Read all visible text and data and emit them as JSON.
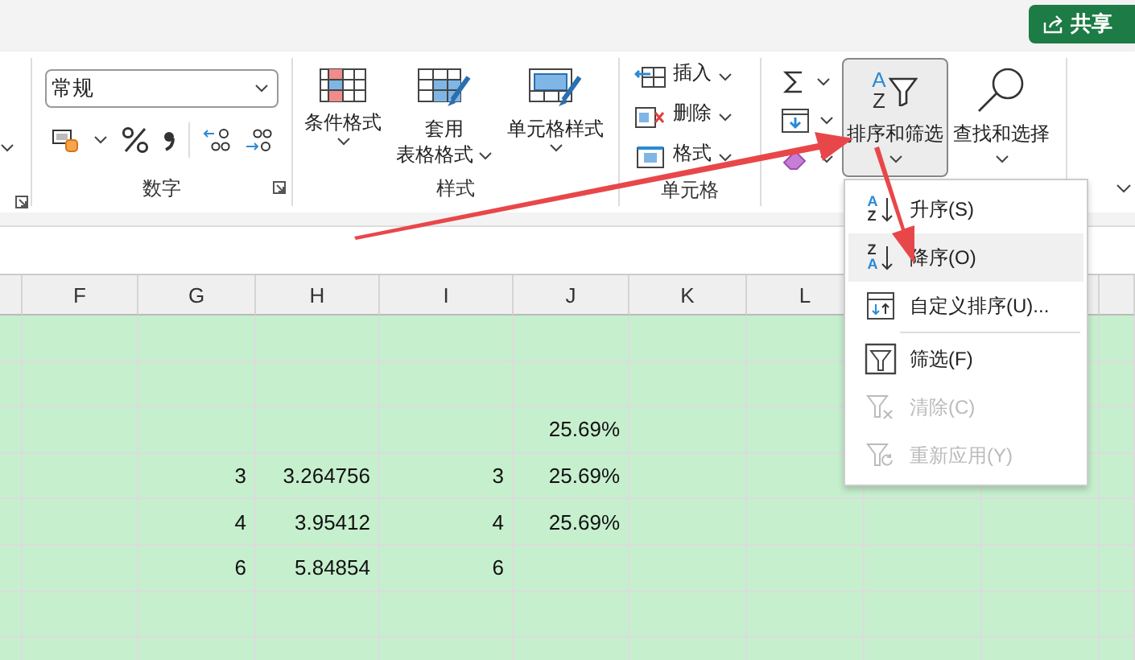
{
  "share_button": {
    "label": "共享"
  },
  "ribbon": {
    "number": {
      "label": "数字",
      "format": "常规"
    },
    "styles": {
      "label": "样式",
      "buttons": [
        {
          "lines": [
            "条件格式"
          ],
          "kind": "conditional"
        },
        {
          "lines": [
            "套用",
            "表格格式"
          ],
          "kind": "table"
        },
        {
          "lines": [
            "单元格样式"
          ],
          "kind": "cellstyle"
        }
      ]
    },
    "cells": {
      "label": "单元格",
      "items": [
        {
          "label": "插入",
          "kind": "insert"
        },
        {
          "label": "删除",
          "kind": "delete"
        },
        {
          "label": "格式",
          "kind": "format"
        }
      ]
    },
    "editing": {
      "sort_filter": {
        "label": "排序和筛选",
        "icon_letters": [
          "A",
          "Z"
        ],
        "pressed": true
      },
      "find_select": {
        "label": "查找和选择"
      }
    }
  },
  "columns": [
    "F",
    "G",
    "H",
    "I",
    "J",
    "K",
    "L"
  ],
  "rows": [
    {
      "J": "25.69%"
    },
    {
      "G": "3",
      "H": "3.264756",
      "I": "3",
      "J": "25.69%"
    },
    {
      "G": "4",
      "H": "3.95412",
      "I": "4",
      "J": "25.69%"
    },
    {
      "G": "6",
      "H": "5.84854",
      "I": "6"
    }
  ],
  "menu": {
    "sections": [
      {
        "items": [
          {
            "label": "升序(S)",
            "kind": "sort",
            "icon_letters": [
              "A",
              "Z"
            ],
            "selected": false,
            "disabled": false
          },
          {
            "label": "降序(O)",
            "kind": "sort",
            "icon_letters": [
              "Z",
              "A"
            ],
            "selected": true,
            "disabled": false
          },
          {
            "label": "自定义排序(U)...",
            "kind": "custom",
            "selected": false,
            "disabled": false
          }
        ]
      },
      {
        "items": [
          {
            "label": "筛选(F)",
            "kind": "filter",
            "selected": false,
            "disabled": false
          },
          {
            "label": "清除(C)",
            "kind": "clear",
            "selected": false,
            "disabled": true
          },
          {
            "label": "重新应用(Y)",
            "kind": "reapply",
            "selected": false,
            "disabled": true
          }
        ]
      }
    ]
  }
}
